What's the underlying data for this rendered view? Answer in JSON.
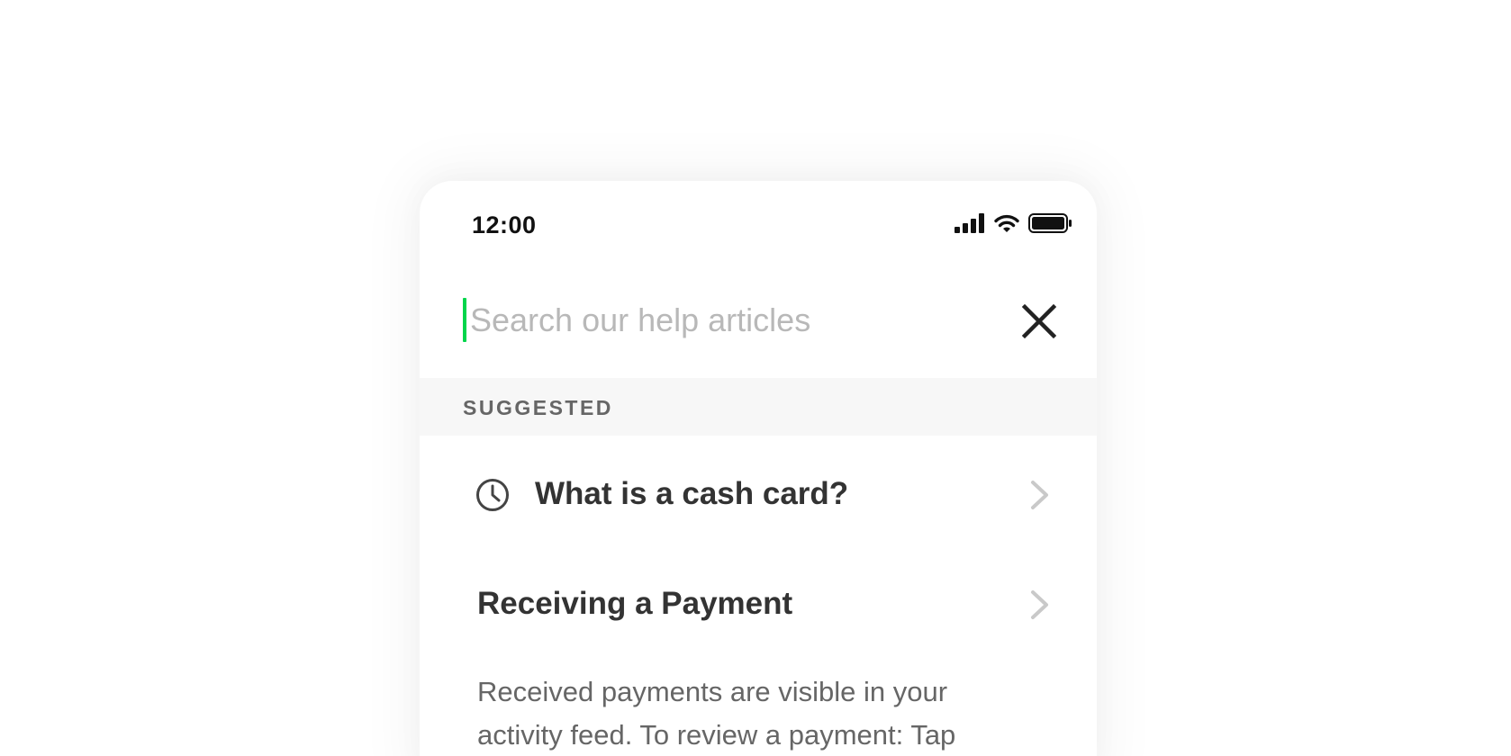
{
  "status_bar": {
    "time": "12:00",
    "icons": [
      "cellular-signal-icon",
      "wifi-icon",
      "battery-icon"
    ]
  },
  "search": {
    "placeholder": "Search our help articles",
    "value": "",
    "close_icon": "close-icon",
    "caret_color": "#00d54b"
  },
  "section": {
    "label": "SUGGESTED"
  },
  "suggestions": [
    {
      "title": "What is a cash card?",
      "icon": "clock-icon",
      "chevron": "chevron-right-icon"
    },
    {
      "title": "Receiving a Payment",
      "chevron": "chevron-right-icon",
      "description": "Received payments are visible in your activity feed. To review a payment: Tap"
    }
  ],
  "colors": {
    "accent": "#00d54b",
    "section_background": "#f7f7f7",
    "title_text": "#333333",
    "muted_text": "#666666",
    "placeholder_text": "#b8b8b8"
  }
}
